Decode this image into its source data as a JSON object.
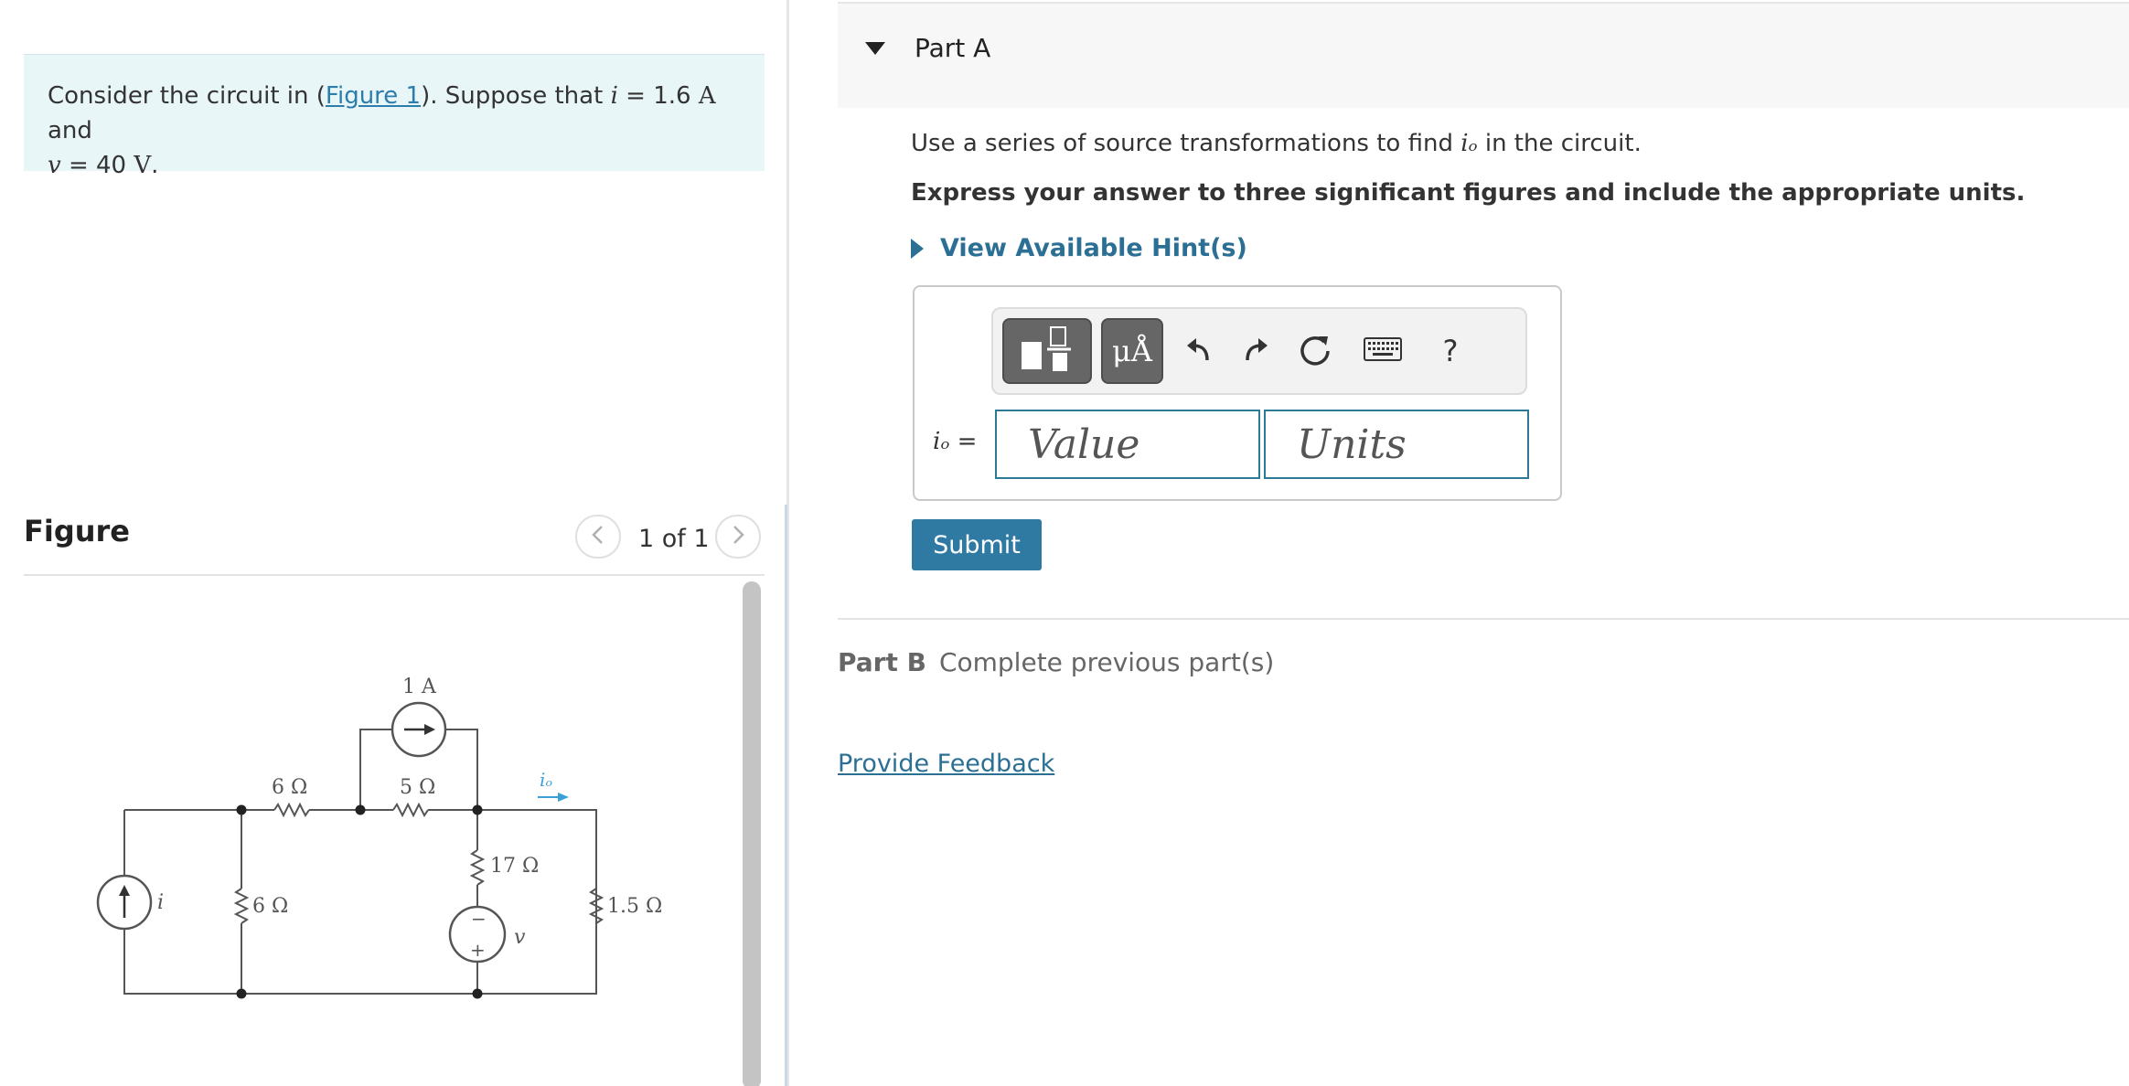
{
  "intro": {
    "prefix": "Consider the circuit in (",
    "figure_link": "Figure 1",
    "middle": "). Suppose that ",
    "i_symbol": "i",
    "i_value": " = 1.6 ",
    "i_unit": "A",
    "and": " and",
    "v_symbol": "v",
    "v_value": " = 40 ",
    "v_unit": "V",
    "end": "."
  },
  "figure": {
    "title": "Figure",
    "counter": "1 of 1",
    "prev_icon": "<",
    "next_icon": ">",
    "labels": {
      "source_1a": "1 A",
      "r_top_left": "6 Ω",
      "r_top_right": "5 Ω",
      "io": "iₒ",
      "r_17": "17 Ω",
      "r_left": "6 Ω",
      "r_15": "1.5 Ω",
      "i": "i",
      "v": "v",
      "minus": "−",
      "plus": "+"
    }
  },
  "part_a": {
    "title": "Part A",
    "question_prefix": "Use a series of source transformations to find ",
    "question_var": "iₒ",
    "question_suffix": " in the circuit.",
    "instructions": "Express your answer to three significant figures and include the appropriate units.",
    "hints_label": "View Available Hint(s)",
    "toolbar": {
      "units_label": "μÅ",
      "help_label": "?"
    },
    "answer_label_var": "iₒ",
    "answer_label_eq": " =",
    "value_placeholder": "Value",
    "units_placeholder": "Units",
    "submit_label": "Submit"
  },
  "part_b": {
    "label": "Part B",
    "status": "Complete previous part(s)"
  },
  "feedback_link": "Provide Feedback"
}
